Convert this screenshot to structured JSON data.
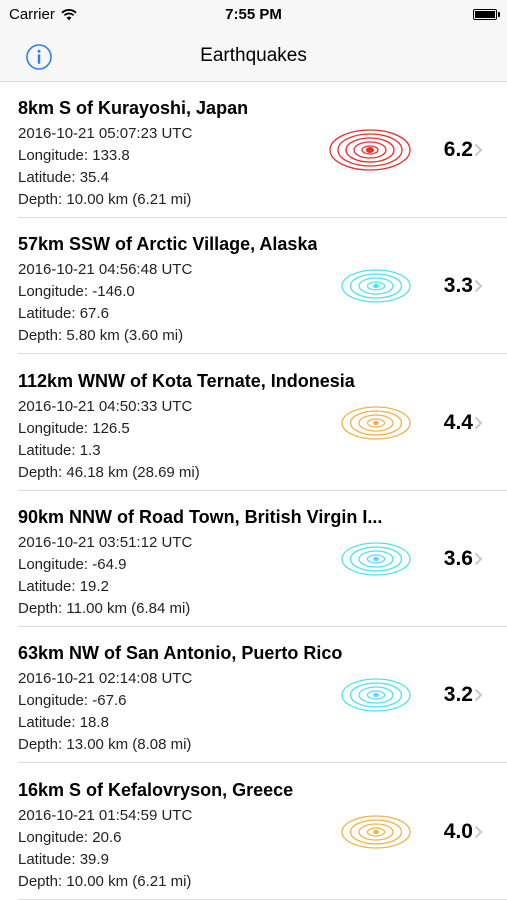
{
  "status_bar": {
    "carrier": "Carrier",
    "time": "7:55 PM",
    "wifi_icon": "wifi-icon",
    "battery_icon": "battery-icon"
  },
  "nav": {
    "title": "Earthquakes",
    "info_icon": "info-icon",
    "accent_color": "#2f7df6"
  },
  "colors": {
    "high": "#ef2b2b",
    "medium": "#f0b24a",
    "low": "#4fe3ee"
  },
  "quakes": [
    {
      "title": "8km S of Kurayoshi, Japan",
      "time": "2016-10-21 05:07:23 UTC",
      "longitude": "Longitude: 133.8",
      "latitude": "Latitude: 35.4",
      "depth": "Depth: 10.00 km (6.21 mi)",
      "magnitude": "6.2",
      "level": "high"
    },
    {
      "title": "57km SSW of Arctic Village, Alaska",
      "time": "2016-10-21 04:56:48 UTC",
      "longitude": "Longitude: -146.0",
      "latitude": "Latitude: 67.6",
      "depth": "Depth: 5.80 km (3.60 mi)",
      "magnitude": "3.3",
      "level": "low"
    },
    {
      "title": "112km WNW of Kota Ternate, Indonesia",
      "time": "2016-10-21 04:50:33 UTC",
      "longitude": "Longitude: 126.5",
      "latitude": "Latitude: 1.3",
      "depth": "Depth: 46.18 km (28.69 mi)",
      "magnitude": "4.4",
      "level": "medium"
    },
    {
      "title": "90km NNW of Road Town, British Virgin I...",
      "time": "2016-10-21 03:51:12 UTC",
      "longitude": "Longitude: -64.9",
      "latitude": "Latitude: 19.2",
      "depth": "Depth: 11.00 km (6.84 mi)",
      "magnitude": "3.6",
      "level": "low"
    },
    {
      "title": "63km NW of San Antonio, Puerto Rico",
      "time": "2016-10-21 02:14:08 UTC",
      "longitude": "Longitude: -67.6",
      "latitude": "Latitude: 18.8",
      "depth": "Depth: 13.00 km (8.08 mi)",
      "magnitude": "3.2",
      "level": "low"
    },
    {
      "title": "16km S of Kefalovryson, Greece",
      "time": "2016-10-21 01:54:59 UTC",
      "longitude": "Longitude: 20.6",
      "latitude": "Latitude: 39.9",
      "depth": "Depth: 10.00 km (6.21 mi)",
      "magnitude": "4.0",
      "level": "medium"
    }
  ]
}
